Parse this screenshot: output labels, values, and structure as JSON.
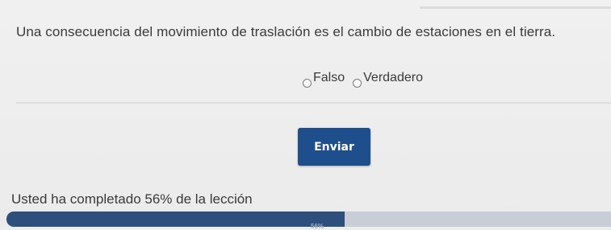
{
  "question": {
    "text": "Una consecuencia del movimiento de traslación es el cambio de estaciones en el tierra."
  },
  "options": [
    {
      "label": "Falso",
      "selected": false
    },
    {
      "label": "Verdadero",
      "selected": false
    }
  ],
  "submit": {
    "label": "Enviar"
  },
  "progress": {
    "text": "Usted ha completado 56% de la lección",
    "percent": 56,
    "bar_label": "56%"
  },
  "colors": {
    "button": "#1f4e8c",
    "progress_fill": "#2d4f7c",
    "progress_track": "#c9ced6"
  }
}
